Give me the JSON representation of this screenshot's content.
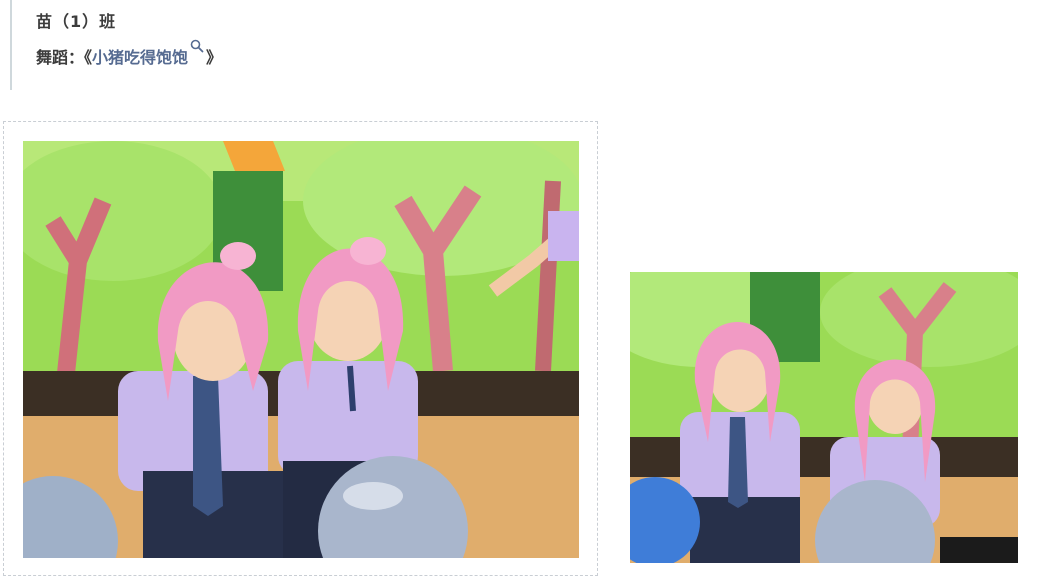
{
  "article": {
    "class_name": "苗（1）班",
    "dance_prefix": "舞蹈：《",
    "dance_title": "小猪吃得饱饱",
    "dance_suffix": "》"
  },
  "icons": {
    "search": "search-icon"
  },
  "photos": [
    {
      "name": "photo-two-children-pig-hats"
    },
    {
      "name": "photo-two-children-pig-hats-2"
    }
  ],
  "colors": {
    "link": "#566b91",
    "text": "#3c3c3c",
    "backdrop_green": "#8ccf3e",
    "pig_pink": "#f19ac4",
    "uniform_lavender": "#c8b8ec"
  }
}
